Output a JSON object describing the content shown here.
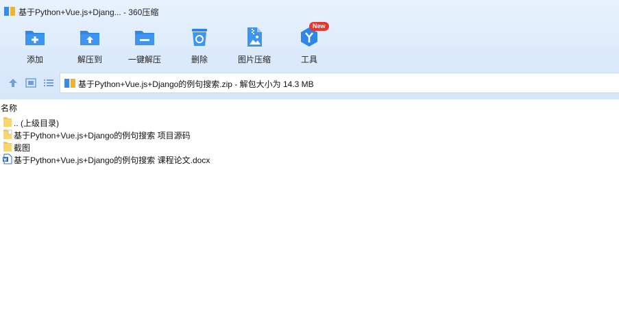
{
  "window": {
    "title": "基于Python+Vue.js+Djang... - 360压缩"
  },
  "toolbar": {
    "buttons": [
      {
        "label": "添加",
        "icon": "add-icon"
      },
      {
        "label": "解压到",
        "icon": "extract-to-icon"
      },
      {
        "label": "一键解压",
        "icon": "one-click-extract-icon"
      },
      {
        "label": "删除",
        "icon": "delete-icon"
      },
      {
        "label": "图片压缩",
        "icon": "image-compress-icon"
      },
      {
        "label": "工具",
        "icon": "tools-icon",
        "badge": "New"
      }
    ]
  },
  "nav": {
    "up_icon": "up-arrow-icon",
    "thumb_view_icon": "thumbnail-view-icon",
    "list_view_icon": "list-view-icon"
  },
  "pathbar": {
    "text": "基于Python+Vue.js+Django的例句搜索.zip - 解包大小为 14.3 MB"
  },
  "list": {
    "column_name": "名称",
    "items": [
      {
        "name": ".. (上级目录)",
        "type": "parent-folder"
      },
      {
        "name": "基于Python+Vue.js+Django的例句搜索 项目源码",
        "type": "folder-doc"
      },
      {
        "name": "截图",
        "type": "folder"
      },
      {
        "name": "基于Python+Vue.js+Django的例句搜索 课程论文.docx",
        "type": "word-doc"
      }
    ]
  },
  "colors": {
    "accent": "#2f86e6",
    "badge": "#e8362e",
    "folder": "#f5c84b"
  }
}
